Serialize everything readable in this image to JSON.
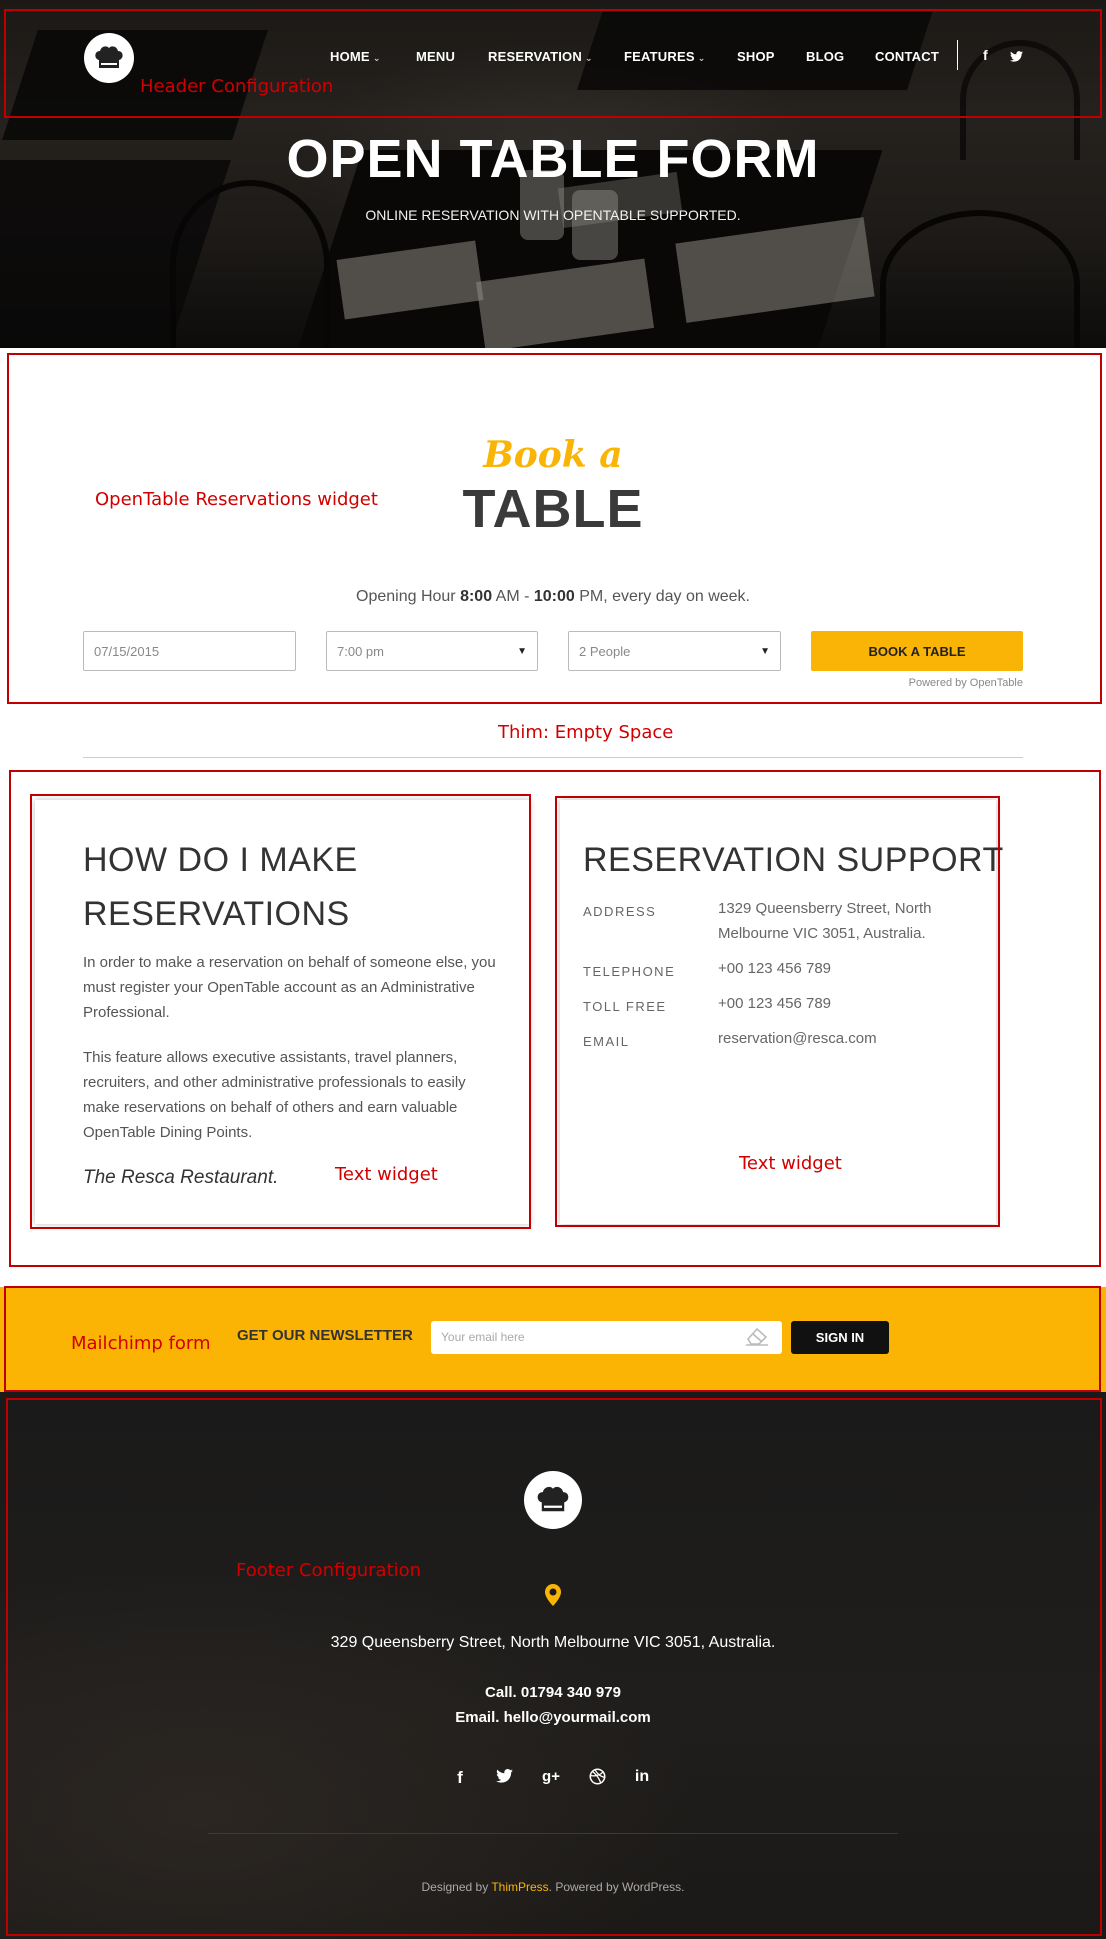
{
  "header": {
    "nav": [
      {
        "label": "HOME",
        "has_dropdown": true
      },
      {
        "label": "MENU",
        "has_dropdown": false
      },
      {
        "label": "RESERVATION",
        "has_dropdown": true
      },
      {
        "label": "FEATURES",
        "has_dropdown": true
      },
      {
        "label": "SHOP",
        "has_dropdown": false
      },
      {
        "label": "BLOG",
        "has_dropdown": false
      },
      {
        "label": "CONTACT",
        "has_dropdown": false
      }
    ],
    "social": [
      "facebook-icon",
      "twitter-icon"
    ],
    "social_glyphs": [
      "f",
      "🐦"
    ]
  },
  "hero": {
    "title": "OPEN TABLE FORM",
    "subtitle": "ONLINE RESERVATION WITH OPENTABLE SUPPORTED."
  },
  "booking": {
    "script_title": "Book a",
    "title": "TABLE",
    "opening_prefix": "Opening Hour ",
    "opening_start": "8:00",
    "opening_am": " AM - ",
    "opening_end": "10:00",
    "opening_suffix": " PM, every day on week.",
    "date_value": "07/15/2015",
    "time_value": "7:00 pm",
    "people_value": "2 People",
    "button": "BOOK A TABLE",
    "powered": "Powered by OpenTable"
  },
  "how_card": {
    "heading_line1": "HOW DO I MAKE",
    "heading_line2": "RESERVATIONS",
    "para1": "In order to make a reservation on behalf of someone else, you must register your OpenTable account as an Administrative Professional.",
    "para2": "This feature allows executive assistants, travel planners, recruiters, and other administrative professionals to easily make reservations on behalf of others and earn valuable OpenTable Dining Points.",
    "signature": "The Resca Restaurant."
  },
  "support_card": {
    "heading": "RESERVATION SUPPORT",
    "rows": [
      {
        "label": "ADDRESS",
        "value": "1329 Queensberry Street, North Melbourne VIC 3051, Australia."
      },
      {
        "label": "TELEPHONE",
        "value": "+00 123 456 789"
      },
      {
        "label": "TOLL FREE",
        "value": "+00 123 456 789"
      },
      {
        "label": "EMAIL",
        "value": "reservation@resca.com"
      }
    ]
  },
  "newsletter": {
    "label": "GET OUR NEWSLETTER",
    "placeholder": "Your email here",
    "button": "SIGN IN"
  },
  "footer": {
    "address": "329 Queensberry Street, North Melbourne VIC 3051, Australia.",
    "call": "Call. 01794 340 979",
    "email": "Email. hello@yourmail.com",
    "social": [
      "facebook-icon",
      "twitter-icon",
      "google-plus-icon",
      "dribbble-icon",
      "linkedin-icon"
    ],
    "credits_prefix": "Designed by ",
    "credits_brand": "ThimPress",
    "credits_suffix": ". Powered by WordPress."
  },
  "annotations": {
    "header": "Header Configuration",
    "opentable": "OpenTable Reservations widget",
    "empty_space": "Thim: Empty Space",
    "text_widget_1": "Text widget",
    "text_widget_2": "Text widget",
    "mailchimp": "Mailchimp form",
    "footer": "Footer Configuration"
  },
  "colors": {
    "accent": "#f9b406",
    "newsletter_bg": "#fbb404",
    "annotation_red": "#c00000",
    "footer_bg": "#1c1a18"
  }
}
